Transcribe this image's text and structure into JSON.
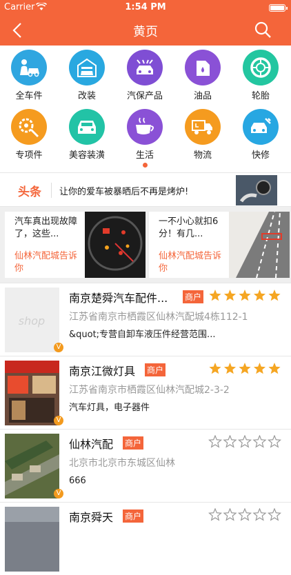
{
  "status": {
    "carrier": "Carrier",
    "time": "1:54 PM"
  },
  "nav": {
    "title": "黄页"
  },
  "categories": [
    {
      "label": "全车件",
      "color": "#2fa6e0",
      "icon": "car-wash-person-icon"
    },
    {
      "label": "改装",
      "color": "#29a8e0",
      "icon": "garage-car-icon"
    },
    {
      "label": "汽保产品",
      "color": "#7f4ed4",
      "icon": "car-wash-icon"
    },
    {
      "label": "油品",
      "color": "#8a51d6",
      "icon": "oil-can-icon"
    },
    {
      "label": "轮胎",
      "color": "#23c6a0",
      "icon": "tire-icon"
    },
    {
      "label": "专项件",
      "color": "#f59b1f",
      "icon": "gear-parts-icon"
    },
    {
      "label": "美容装潢",
      "color": "#22c3a6",
      "icon": "car-front-icon"
    },
    {
      "label": "生活",
      "color": "#8a51d6",
      "icon": "coffee-cup-icon"
    },
    {
      "label": "物流",
      "color": "#f59b1f",
      "icon": "delivery-truck-icon"
    },
    {
      "label": "快修",
      "color": "#27a7e2",
      "icon": "car-repair-icon"
    }
  ],
  "news": {
    "tag": "头条",
    "text": "让你的爱车被暴晒后不再是烤炉!"
  },
  "articles": [
    {
      "title": "汽车真出现故障了，这些...",
      "source": "仙林汽配城告诉你"
    },
    {
      "title": "一不小心就扣6分！有几...",
      "source": "仙林汽配城告诉你"
    }
  ],
  "shops": [
    {
      "name": "南京楚舜汽车配件...",
      "badge": "商户",
      "rating": 5,
      "address": "江苏省南京市栖霞区仙林汽配城4栋112-1",
      "desc": "&quot;专营自卸车液压件经营范围..."
    },
    {
      "name": "南京江微灯具",
      "badge": "商户",
      "rating": 5,
      "address": "江苏省南京市栖霞区仙林汽配城2-3-2",
      "desc": "汽车灯具，电子器件"
    },
    {
      "name": "仙林汽配",
      "badge": "商户",
      "rating": 0,
      "address": "北京市北京市东城区仙林",
      "desc": "666"
    },
    {
      "name": "南京舜天",
      "badge": "商户",
      "rating": 0,
      "address": "",
      "desc": ""
    }
  ],
  "colors": {
    "accent": "#f4653a",
    "star": "#f5a623"
  },
  "badge_v": "V"
}
